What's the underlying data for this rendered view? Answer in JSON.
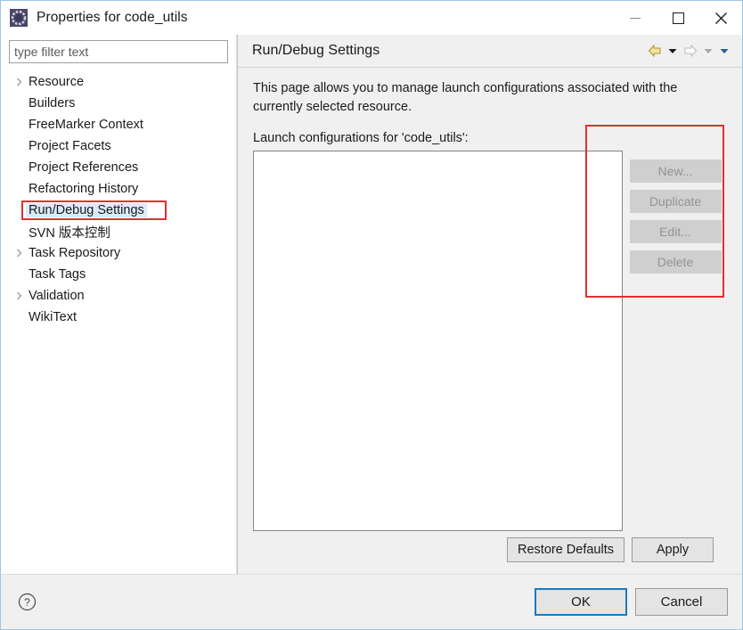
{
  "window": {
    "title": "Properties for code_utils",
    "icon": "eclipse-properties-icon",
    "controls": {
      "minimize": "Minimize",
      "maximize": "Maximize",
      "close": "Close"
    }
  },
  "sidebar": {
    "filter": {
      "placeholder": "type filter text",
      "value": ""
    },
    "items": [
      {
        "label": "Resource",
        "expandable": true,
        "selected": false
      },
      {
        "label": "Builders",
        "expandable": false,
        "selected": false
      },
      {
        "label": "FreeMarker Context",
        "expandable": false,
        "selected": false
      },
      {
        "label": "Project Facets",
        "expandable": false,
        "selected": false
      },
      {
        "label": "Project References",
        "expandable": false,
        "selected": false
      },
      {
        "label": "Refactoring History",
        "expandable": false,
        "selected": false
      },
      {
        "label": "Run/Debug Settings",
        "expandable": false,
        "selected": true
      },
      {
        "label": "SVN 版本控制",
        "expandable": false,
        "selected": false
      },
      {
        "label": "Task Repository",
        "expandable": true,
        "selected": false
      },
      {
        "label": "Task Tags",
        "expandable": false,
        "selected": false
      },
      {
        "label": "Validation",
        "expandable": true,
        "selected": false
      },
      {
        "label": "WikiText",
        "expandable": false,
        "selected": false
      }
    ]
  },
  "page": {
    "title": "Run/Debug Settings",
    "nav": {
      "back": "back-arrow",
      "back_menu": "back-dropdown",
      "forward": "forward-arrow",
      "forward_menu": "forward-dropdown",
      "menu": "view-menu-dropdown"
    },
    "description": "This page allows you to manage launch configurations associated with the currently selected resource.",
    "list_label": "Launch configurations for 'code_utils':",
    "list_items": [],
    "side_buttons": [
      {
        "label": "New...",
        "enabled": false
      },
      {
        "label": "Duplicate",
        "enabled": false
      },
      {
        "label": "Edit...",
        "enabled": false
      },
      {
        "label": "Delete",
        "enabled": false
      }
    ],
    "footer_buttons": [
      {
        "label": "Restore Defaults",
        "enabled": true
      },
      {
        "label": "Apply",
        "enabled": true
      }
    ]
  },
  "dialog_buttons": {
    "help": "help-icon",
    "ok": "OK",
    "cancel": "Cancel"
  },
  "annotations": [
    {
      "target": "sidebar-item-run-debug-settings",
      "color": "#e03030",
      "shape": "rectangle"
    },
    {
      "target": "launch-config-button-column",
      "color": "#e03030",
      "shape": "rectangle"
    }
  ],
  "colors": {
    "accent": "#1a7ac0",
    "annotation": "#e03030",
    "selection": "#d9ecfb",
    "panel_bg": "#f0f0f0",
    "window_border": "#9fc6e0"
  }
}
